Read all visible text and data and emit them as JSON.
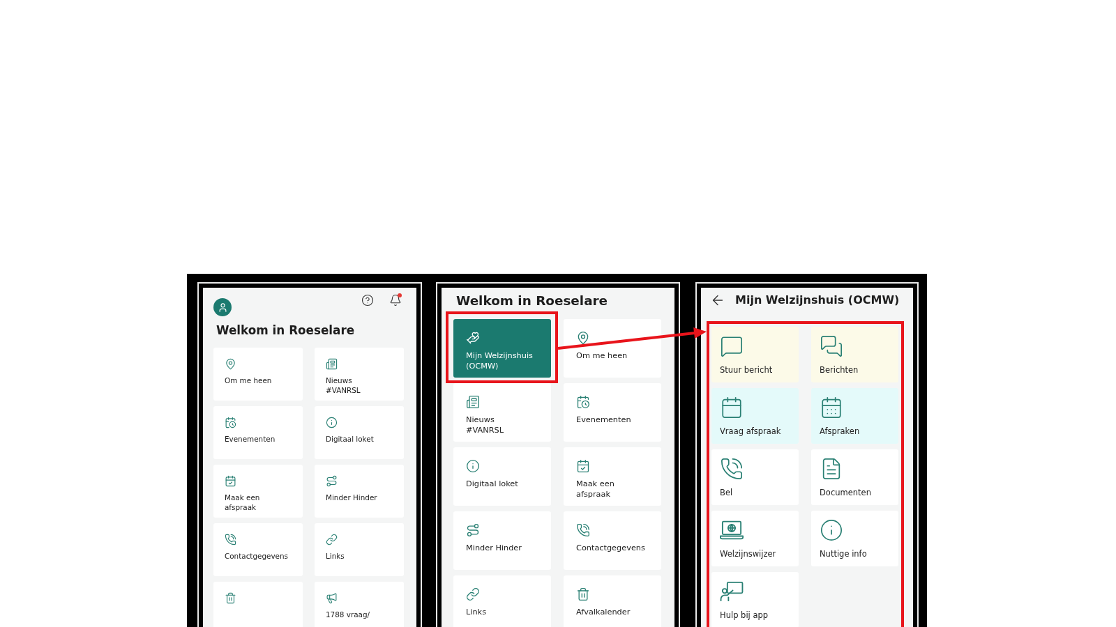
{
  "screens": [
    {
      "kind": "home",
      "header": {
        "notification_dot": true
      },
      "title": "Welkom in Roeselare",
      "tiles": [
        {
          "label": "Om me heen",
          "selected": false
        },
        {
          "label": "Nieuws\n#VANRSL",
          "selected": false
        },
        {
          "label": "Evenementen",
          "selected": false
        },
        {
          "label": "Digitaal loket",
          "selected": false
        },
        {
          "label": "Maak een\nafspraak",
          "selected": false
        },
        {
          "label": "Minder Hinder",
          "selected": false
        },
        {
          "label": "Contactgegevens",
          "selected": false
        },
        {
          "label": "Links",
          "selected": false
        },
        {
          "selected": false
        },
        {
          "label": "1788 vraag/",
          "selected": false
        }
      ]
    },
    {
      "kind": "home",
      "title": "Welkom in Roeselare",
      "tiles": [
        {
          "label": "Mijn Welzijnshuis\n(OCMW)",
          "selected": true
        },
        {
          "label": "Om me heen",
          "selected": false
        },
        {
          "label": "Nieuws\n#VANRSL",
          "selected": false
        },
        {
          "label": "Evenementen",
          "selected": false
        },
        {
          "label": "Digitaal loket",
          "selected": false
        },
        {
          "label": "Maak een\nafspraak",
          "selected": false
        },
        {
          "label": "Minder Hinder",
          "selected": false
        },
        {
          "label": "Contactgegevens",
          "selected": false
        },
        {
          "label": "Links",
          "selected": false
        },
        {
          "label": "Afvalkalender",
          "selected": false
        }
      ]
    },
    {
      "kind": "detail",
      "title": "Mijn Welzijnshuis (OCMW)",
      "tiles": [
        {
          "label": "Stuur bericht",
          "color": "#fcfae8"
        },
        {
          "label": "Berichten",
          "color": "#fcfae8"
        },
        {
          "label": "Vraag afspraak",
          "color": "#e4fafa"
        },
        {
          "label": "Afspraken",
          "color": "#e4fafa"
        },
        {
          "label": "Bel",
          "color": "#ffffff"
        },
        {
          "label": "Documenten",
          "color": "#ffffff"
        },
        {
          "label": "Welzijnswijzer",
          "color": "#ffffff"
        },
        {
          "label": "Nuttige info",
          "color": "#ffffff"
        },
        {
          "label": "Hulp bij app",
          "color": "#ffffff"
        }
      ]
    }
  ]
}
